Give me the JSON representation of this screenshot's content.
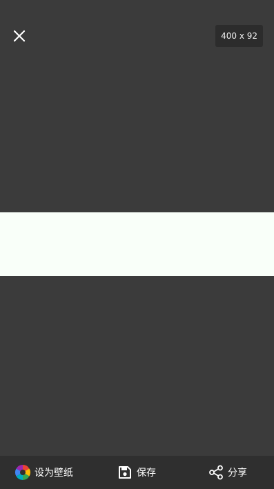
{
  "viewer": {
    "dimensions": "400 x 92",
    "image_color": "#f9fff9",
    "close_icon": "close-icon"
  },
  "bottom_bar": {
    "set_wallpaper_label": "设为壁纸",
    "save_label": "保存",
    "share_label": "分享",
    "icons": [
      "color-wheel-icon",
      "floppy-disk-icon",
      "share-icon"
    ]
  },
  "colors": {
    "background": "#3b3b3b",
    "bar_background": "#2f2f2f",
    "badge_background": "#2c2c2c"
  }
}
